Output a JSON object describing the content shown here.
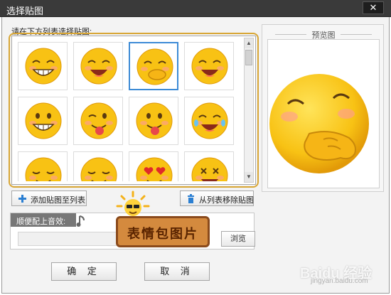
{
  "window": {
    "title": "选择贴图",
    "close_label": "✕"
  },
  "picker": {
    "label": "请在下方列表选择贴图:",
    "stickers": [
      {
        "name": "grinning-teeth"
      },
      {
        "name": "laughing-squint"
      },
      {
        "name": "covering-mouth-smile"
      },
      {
        "name": "open-mouth-laugh"
      },
      {
        "name": "big-grin-cheeky"
      },
      {
        "name": "wink-tongue"
      },
      {
        "name": "silly-tongue"
      },
      {
        "name": "tears-of-joy"
      },
      {
        "name": "content-smile"
      },
      {
        "name": "peek-smile"
      },
      {
        "name": "heart-eyes"
      },
      {
        "name": "dizzy-face"
      }
    ],
    "selected_index": 2,
    "scroll_fraction": 0.0
  },
  "preview": {
    "title": "预览图"
  },
  "actions": {
    "add_label": "添加贴图至列表",
    "remove_label": "从列表移除贴图"
  },
  "sound": {
    "label": "顺便配上音效:",
    "value": "",
    "browse_label": "浏览"
  },
  "footer": {
    "ok_label": "确 定",
    "cancel_label": "取 消"
  },
  "annotation": {
    "text": "表情包图片"
  },
  "watermark": {
    "brand": "Baidu 经验",
    "url": "jingyan.baidu.com"
  },
  "colors": {
    "titlebar": "#3a3a3a",
    "selection": "#3d8bd6",
    "highlight_frame": "#d8a635",
    "emoji_yellow": "#f8c214",
    "annotation_fill": "#d48a3e"
  }
}
